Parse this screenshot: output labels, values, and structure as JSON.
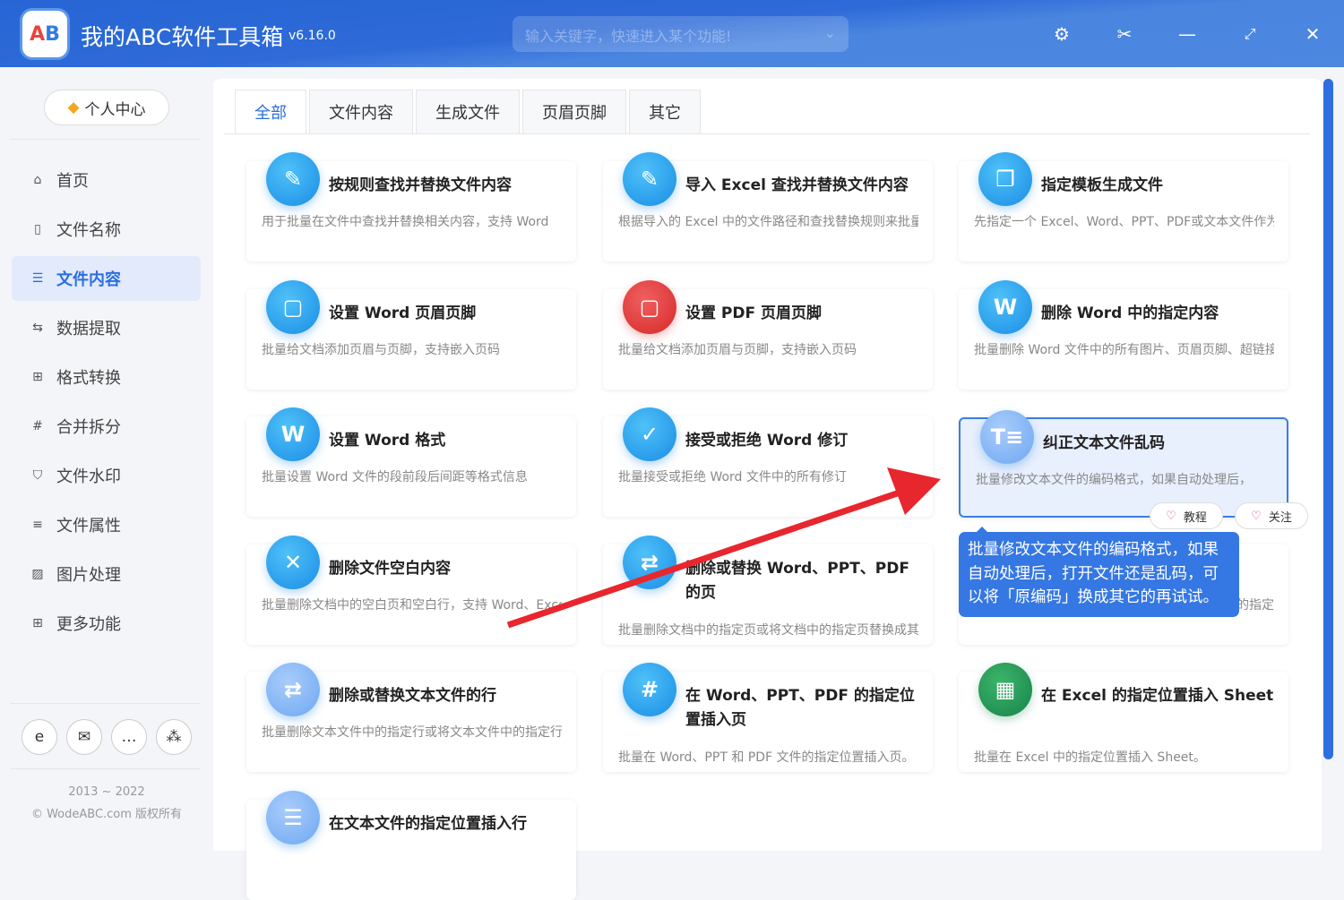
{
  "app": {
    "title": "我的ABC软件工具箱",
    "version": "v6.16.0",
    "search_placeholder": "输入关键字，快速进入某个功能!"
  },
  "sidebar": {
    "user_center": "个人中心",
    "items": [
      {
        "label": "首页",
        "icon": "home-icon",
        "glyph": "⌂"
      },
      {
        "label": "文件名称",
        "icon": "file-icon",
        "glyph": "▯"
      },
      {
        "label": "文件内容",
        "icon": "list-icon",
        "glyph": "☰"
      },
      {
        "label": "数据提取",
        "icon": "extract-icon",
        "glyph": "⇆"
      },
      {
        "label": "格式转换",
        "icon": "convert-icon",
        "glyph": "⊞"
      },
      {
        "label": "合并拆分",
        "icon": "hash-icon",
        "glyph": "#"
      },
      {
        "label": "文件水印",
        "icon": "shield-icon",
        "glyph": "⛉"
      },
      {
        "label": "文件属性",
        "icon": "properties-icon",
        "glyph": "≡"
      },
      {
        "label": "图片处理",
        "icon": "image-icon",
        "glyph": "▨"
      },
      {
        "label": "更多功能",
        "icon": "grid-icon",
        "glyph": "⊞"
      }
    ],
    "copyright_years": "2013 ~ 2022",
    "copyright": "© WodeABC.com 版权所有"
  },
  "tabs": [
    "全部",
    "文件内容",
    "生成文件",
    "页眉页脚",
    "其它"
  ],
  "cards": [
    {
      "title": "按规则查找并替换文件内容",
      "desc": "用于批量在文件中查找并替换相关内容，支持 Word",
      "color": "blue",
      "glyph": "✎"
    },
    {
      "title": "导入 Excel 查找并替换文件内容",
      "desc": "根据导入的 Excel 中的文件路径和查找替换规则来批量",
      "color": "blue",
      "glyph": "✎"
    },
    {
      "title": "指定模板生成文件",
      "desc": "先指定一个 Excel、Word、PPT、PDF或文本文件作为",
      "color": "blue",
      "glyph": "❐"
    },
    {
      "title": "设置 Word 页眉页脚",
      "desc": "批量给文档添加页眉与页脚，支持嵌入页码",
      "color": "blue",
      "glyph": "▢"
    },
    {
      "title": "设置 PDF 页眉页脚",
      "desc": "批量给文档添加页眉与页脚，支持嵌入页码",
      "color": "red",
      "glyph": "▢"
    },
    {
      "title": "删除 Word 中的指定内容",
      "desc": "批量删除 Word 文件中的所有图片、页眉页脚、超链接",
      "color": "blue",
      "glyph": "W"
    },
    {
      "title": "设置 Word 格式",
      "desc": "批量设置 Word 文件的段前段后间距等格式信息",
      "color": "blue",
      "glyph": "W"
    },
    {
      "title": "接受或拒绝 Word 修订",
      "desc": "批量接受或拒绝 Word 文件中的所有修订",
      "color": "blue",
      "glyph": "✓"
    },
    {
      "title": "纠正文本文件乱码",
      "desc": "批量修改文本文件的编码格式，如果自动处理后，",
      "color": "light",
      "glyph": "T≡"
    },
    {
      "title": "删除文件空白内容",
      "desc": "批量删除文档中的空白页和空白行，支持 Word、Excel",
      "color": "blue",
      "glyph": "✕"
    },
    {
      "title": "删除或替换 Word、PPT、PDF 的页",
      "desc": "批量删除文档中的指定页或将文档中的指定页替换成其它",
      "color": "blue",
      "glyph": "⇄"
    },
    {
      "title": "",
      "desc": "的指定",
      "color": "blue",
      "glyph": ""
    },
    {
      "title": "删除或替换文本文件的行",
      "desc": "批量删除文本文件中的指定行或将文本文件中的指定行",
      "color": "light",
      "glyph": "⇄"
    },
    {
      "title": "在 Word、PPT、PDF 的指定位置插入页",
      "desc": "批量在 Word、PPT 和 PDF 文件的指定位置插入页。",
      "color": "blue",
      "glyph": "#"
    },
    {
      "title": "在 Excel 的指定位置插入 Sheet",
      "desc": "批量在 Excel 中的指定位置插入 Sheet。",
      "color": "green",
      "glyph": "▦"
    },
    {
      "title": "在文本文件的指定位置插入行",
      "desc": "",
      "color": "light",
      "glyph": "☰"
    }
  ],
  "actions": {
    "tutorial": "教程",
    "follow": "关注"
  },
  "tooltip": "批量修改文本文件的编码格式，如果自动处理后，打开文件还是乱码，可以将「原编码」换成其它的再试试。"
}
